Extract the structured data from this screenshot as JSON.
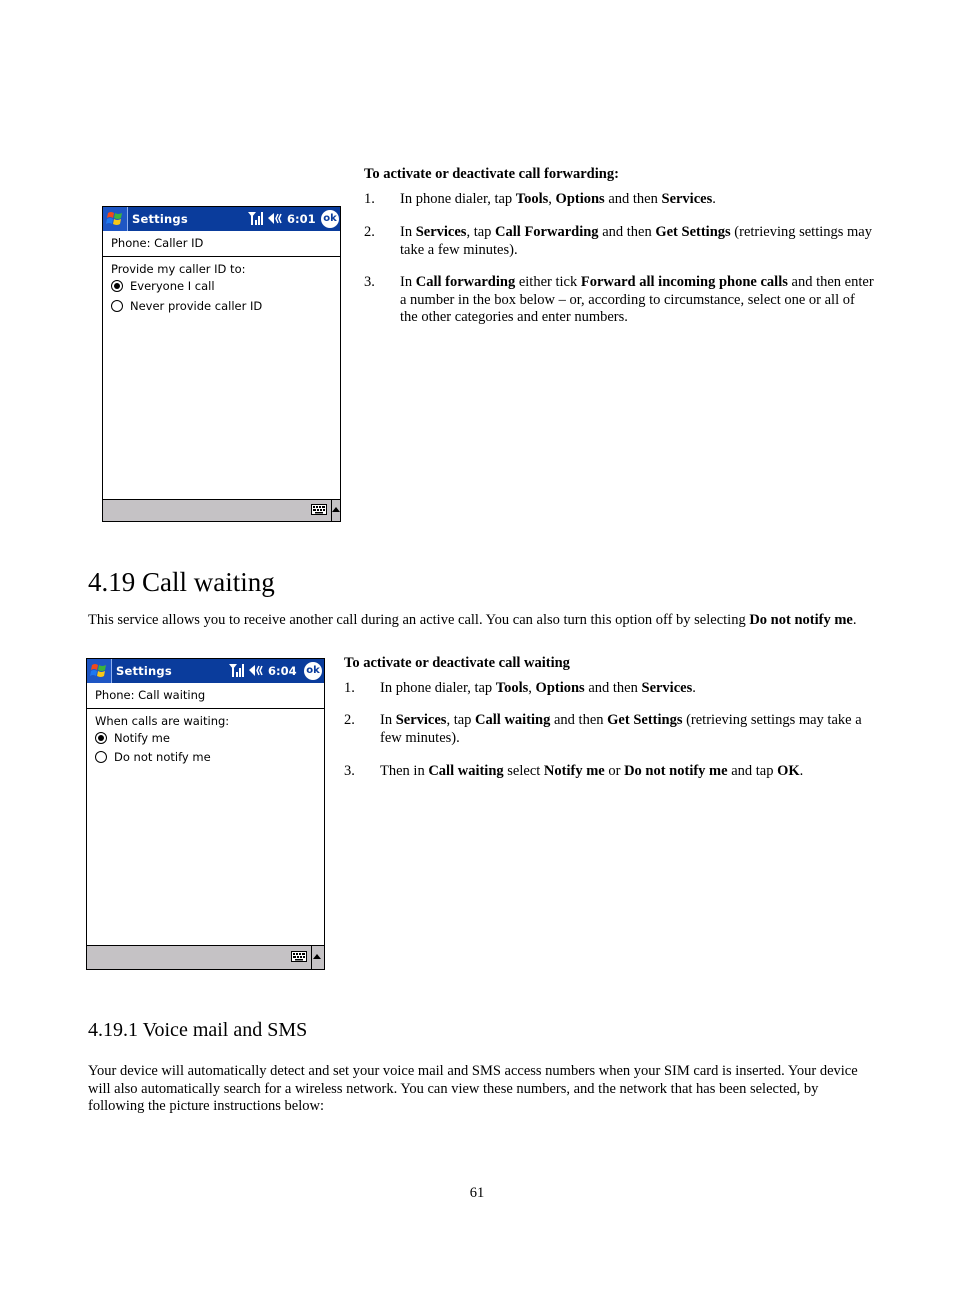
{
  "forwarding": {
    "heading": "To activate or deactivate call forwarding:",
    "steps": [
      {
        "num": "1.",
        "parts": [
          [
            "In phone dialer, tap ",
            false
          ],
          [
            "Tools",
            true
          ],
          [
            ", ",
            false
          ],
          [
            "Options",
            true
          ],
          [
            " and then ",
            false
          ],
          [
            "Services",
            true
          ],
          [
            ".",
            false
          ]
        ]
      },
      {
        "num": "2.",
        "parts": [
          [
            "In ",
            false
          ],
          [
            "Services",
            true
          ],
          [
            ", tap ",
            false
          ],
          [
            "Call Forwarding",
            true
          ],
          [
            " and then ",
            false
          ],
          [
            "Get Settings",
            true
          ],
          [
            " (retrieving settings may take a few minutes).",
            false
          ]
        ]
      },
      {
        "num": "3.",
        "parts": [
          [
            "In ",
            false
          ],
          [
            "Call forwarding",
            true
          ],
          [
            " either tick ",
            false
          ],
          [
            "Forward all incoming phone calls",
            true
          ],
          [
            " and then enter a number in the box below – or, according to circumstance, select one or all of the other categories and enter numbers.",
            false
          ]
        ]
      }
    ]
  },
  "screen1": {
    "app_title": "Settings",
    "time": "6:01",
    "ok_label": "ok",
    "header": "Phone: Caller ID",
    "prompt": "Provide my caller ID to:",
    "options": [
      {
        "label": "Everyone I call",
        "checked": true
      },
      {
        "label": "Never provide caller ID",
        "checked": false
      }
    ]
  },
  "section": {
    "title": "4.19  Call waiting",
    "intro_parts": [
      [
        "This service allows you to receive another call during an active call. You can also turn this option off by selecting ",
        false
      ],
      [
        "Do not notify me",
        true
      ],
      [
        ".",
        false
      ]
    ]
  },
  "screen2": {
    "app_title": "Settings",
    "time": "6:04",
    "ok_label": "ok",
    "header": "Phone: Call waiting",
    "prompt": "When calls are waiting:",
    "options": [
      {
        "label": "Notify me",
        "checked": true
      },
      {
        "label": "Do not notify me",
        "checked": false
      }
    ]
  },
  "waiting": {
    "heading": "To activate or deactivate call waiting",
    "steps": [
      {
        "num": "1.",
        "parts": [
          [
            "In phone dialer, tap ",
            false
          ],
          [
            "Tools",
            true
          ],
          [
            ", ",
            false
          ],
          [
            "Options",
            true
          ],
          [
            " and then ",
            false
          ],
          [
            "Services",
            true
          ],
          [
            ".",
            false
          ]
        ]
      },
      {
        "num": "2.",
        "parts": [
          [
            "In ",
            false
          ],
          [
            "Services",
            true
          ],
          [
            ", tap ",
            false
          ],
          [
            "Call waiting",
            true
          ],
          [
            " and then ",
            false
          ],
          [
            "Get Settings",
            true
          ],
          [
            " (retrieving settings may take a few minutes).",
            false
          ]
        ]
      },
      {
        "num": "3.",
        "parts": [
          [
            "Then in ",
            false
          ],
          [
            "Call waiting",
            true
          ],
          [
            " select ",
            false
          ],
          [
            "Notify me",
            true
          ],
          [
            " or ",
            false
          ],
          [
            "Do not notify me",
            true
          ],
          [
            " and tap ",
            false
          ],
          [
            "OK",
            true
          ],
          [
            ".",
            false
          ]
        ]
      }
    ]
  },
  "subsection": {
    "title": "4.19.1  Voice mail and SMS",
    "body": "Your device will automatically detect and set your voice mail and SMS access numbers when your SIM card is inserted.  Your device will also automatically search for a wireless network.  You can view these numbers, and the network that has been selected, by following the picture instructions below:"
  },
  "page_number": "61"
}
